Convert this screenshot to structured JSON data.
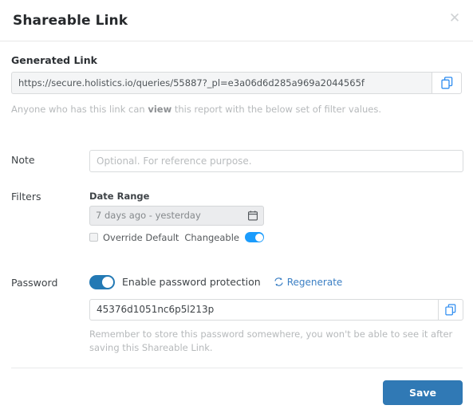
{
  "dialog": {
    "title": "Shareable Link",
    "close_icon": "close-icon"
  },
  "generated_link": {
    "label": "Generated Link",
    "url": "https://secure.holistics.io/queries/55887?_pl=e3a06d6d285a969a2044565f",
    "copy_icon": "copy-icon",
    "hint_before": "Anyone who has this link can ",
    "hint_emphasis": "view",
    "hint_after": " this report with the below set of filter values."
  },
  "note": {
    "label": "Note",
    "value": "",
    "placeholder": "Optional. For reference purpose."
  },
  "filters": {
    "label": "Filters",
    "items": [
      {
        "label": "Date Range",
        "value": "7 days ago - yesterday",
        "calendar_icon": "calendar-icon",
        "override_default_label": "Override Default",
        "override_default_checked": false,
        "changeable_label": "Changeable",
        "changeable_on": true
      }
    ]
  },
  "password": {
    "label": "Password",
    "enable_label": "Enable password protection",
    "enabled": true,
    "regenerate_label": "Regenerate",
    "regenerate_icon": "refresh-icon",
    "value": "45376d1051nc6p5l213p",
    "copy_icon": "copy-icon",
    "hint": "Remember to store this password somewhere, you won't be able to see it after saving this Shareable Link."
  },
  "footer": {
    "save_label": "Save"
  },
  "colors": {
    "primary": "#3079b5",
    "link": "#3b7fc4",
    "toggle_on": "#1b9cfc",
    "toggle_on_dark": "#2379b4",
    "copy_icon": "#2d8cf0"
  }
}
